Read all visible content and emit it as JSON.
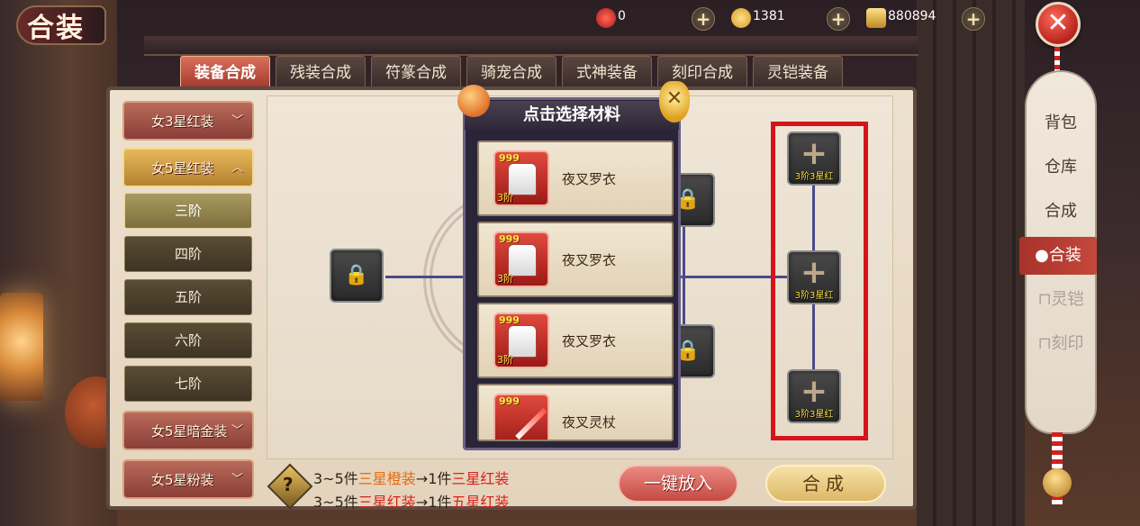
{
  "window": {
    "title": "合装"
  },
  "currency": {
    "red_orb": {
      "icon": "red-orb-icon",
      "value": "0"
    },
    "gold_ingot": {
      "icon": "gold-ingot-icon",
      "value": "1381"
    },
    "coins": {
      "icon": "coin-stack-icon",
      "value": "880894"
    },
    "add_symbol": "+"
  },
  "close_symbol": "✕",
  "tabs": [
    {
      "label": "装备合成",
      "active": true
    },
    {
      "label": "残装合成",
      "active": false
    },
    {
      "label": "符篆合成",
      "active": false
    },
    {
      "label": "骑宠合成",
      "active": false
    },
    {
      "label": "式神装备",
      "active": false
    },
    {
      "label": "刻印合成",
      "active": false
    },
    {
      "label": "灵铠装备",
      "active": false
    }
  ],
  "categories": {
    "c1": "女3星红装",
    "c2": "女5星红装",
    "c3": "女5星暗金装",
    "c4": "女5星粉装"
  },
  "tiers": [
    "三阶",
    "四阶",
    "五阶",
    "六阶",
    "七阶"
  ],
  "popup": {
    "title": "点击选择材料",
    "close_symbol": "✕",
    "items": [
      {
        "name": "夜叉罗衣",
        "qty": "999",
        "tier": "3阶"
      },
      {
        "name": "夜叉罗衣",
        "qty": "999",
        "tier": "3阶"
      },
      {
        "name": "夜叉罗衣",
        "qty": "999",
        "tier": "3阶"
      },
      {
        "name": "夜叉灵杖",
        "qty": "999",
        "tier": ""
      }
    ]
  },
  "slots": {
    "lock_symbol": "🔒",
    "plus_symbol": "+",
    "material_label": "3阶3星红"
  },
  "hints": {
    "line1": {
      "a": "3~5件",
      "b": "三星橙装",
      "c": "→1件",
      "d": "三星红装"
    },
    "line2": {
      "a": "3~5件",
      "b": "三星红装",
      "c": "→1件",
      "d": "五星红装"
    }
  },
  "buttons": {
    "one_click": "一键放入",
    "combine": "合成"
  },
  "sidebar": {
    "items": [
      {
        "label": "背包",
        "state": "normal"
      },
      {
        "label": "仓库",
        "state": "normal"
      },
      {
        "label": "合成",
        "state": "normal"
      },
      {
        "label": "合装",
        "state": "active"
      },
      {
        "label": "灵铠",
        "state": "locked"
      },
      {
        "label": "刻印",
        "state": "locked"
      }
    ]
  },
  "colors": {
    "accent_red": "#d8221a",
    "accent_orange": "#e86a12",
    "highlight_frame": "#d4141a",
    "slot_label": "#ffe34a"
  }
}
